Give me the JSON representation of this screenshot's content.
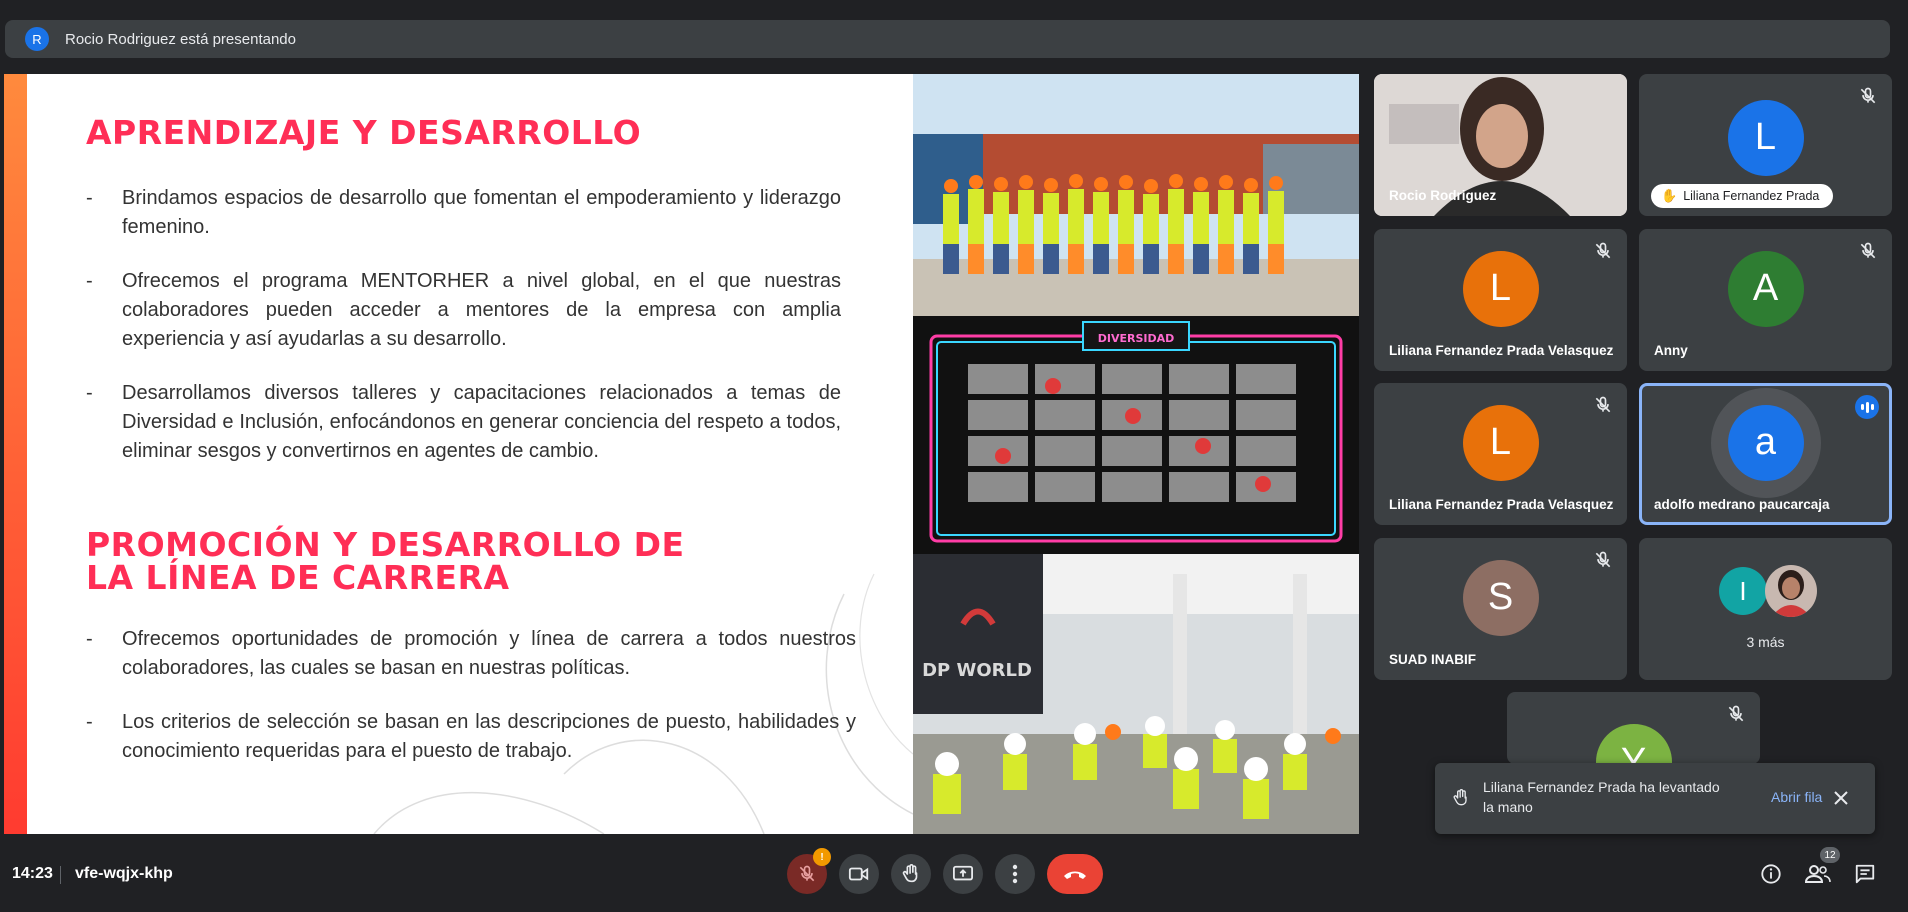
{
  "presenting": {
    "initial": "R",
    "text": "Rocio Rodriguez está presentando"
  },
  "slide": {
    "heading1": "APRENDIZAJE Y DESARROLLO",
    "bullets1": [
      "Brindamos espacios de desarrollo que fomentan el empoderamiento y liderazgo femenino.",
      "Ofrecemos el programa MENTORHER a nivel global, en el que nuestras colaboradores pueden acceder a mentores de la empresa con amplia experiencia y así ayudarlas a su desarrollo.",
      "Desarrollamos diversos talleres y capacitaciones relacionados a temas de Diversidad e Inclusión, enfocándonos en generar conciencia del respeto a todos, eliminar sesgos y convertirnos en agentes de cambio."
    ],
    "heading2_line1": "PROMOCIÓN Y DESARROLLO DE",
    "heading2_line2": "LA LÍNEA DE CARRERA",
    "bullets2": [
      "Ofrecemos oportunidades de promoción y línea de carrera a todos nuestros colaboradores, las cuales se basan en nuestras políticas.",
      "Los criterios de selección se basan en las descripciones de puesto, habilidades y conocimiento requeridas para el puesto de trabajo."
    ],
    "photo2_banner": "DIVERSIDAD",
    "photo3_sign": "DP WORLD"
  },
  "participants": [
    {
      "name": "Rocio Rodriguez",
      "initial": "",
      "color": "",
      "muted": false,
      "video": true
    },
    {
      "name": "",
      "initial": "L",
      "color": "#1a73e8",
      "muted": true,
      "raised_hand_label": "Liliana Fernandez Prada"
    },
    {
      "name": "Liliana Fernandez Prada Velasquez",
      "initial": "L",
      "color": "#e8710a",
      "muted": true
    },
    {
      "name": "Anny",
      "initial": "A",
      "color": "#2e7d32",
      "muted": true
    },
    {
      "name": "Liliana Fernandez Prada Velasquez",
      "initial": "L",
      "color": "#e8710a",
      "muted": true
    },
    {
      "name": "adolfo medrano paucarcaja",
      "initial": "a",
      "color": "#1a73e8",
      "muted": false,
      "speaking": true
    },
    {
      "name": "SUAD INABIF",
      "initial": "S",
      "color": "#8d6e63",
      "muted": true
    },
    {
      "name": "3 más",
      "initial": "I",
      "color": "#12a4a4",
      "muted": false
    },
    {
      "name": "",
      "initial": "Y",
      "color": "#7cb342",
      "muted": true
    }
  ],
  "toast": {
    "text": "Liliana Fernandez Prada ha levantado la mano",
    "action": "Abrir fila",
    "icon": "hand-icon"
  },
  "bottom": {
    "time": "14:23",
    "meeting_code": "vfe-wqjx-khp",
    "mic_alert": "!",
    "people_count": "12"
  },
  "colors": {
    "accent": "#ff2e56",
    "end_call": "#ea4335",
    "link": "#8ab4f8"
  }
}
